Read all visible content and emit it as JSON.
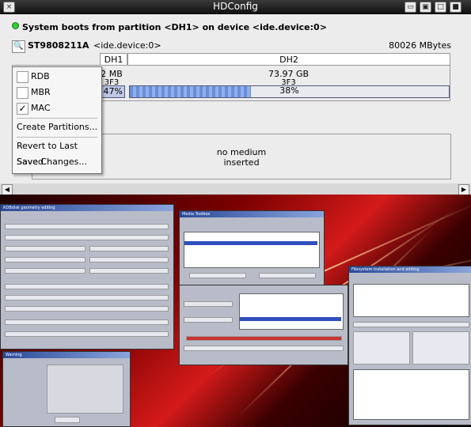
{
  "window": {
    "title": "HDConfig",
    "buttons": [
      "×",
      "□",
      "▣",
      "▢",
      "■"
    ]
  },
  "boot": {
    "text": "System boots from partition <DH1> on device <ide.device:0>"
  },
  "drive": {
    "name": "ST9808211A",
    "device": "<ide.device:0>",
    "capacity": "80026 MBytes"
  },
  "partitions": [
    {
      "name": "DH1",
      "size": "2 MB",
      "fs": "3F3",
      "usage": "47%"
    },
    {
      "name": "DH2",
      "size": "73.97 GB",
      "fs": "3F3",
      "usage": "38%"
    }
  ],
  "menu": {
    "items": [
      {
        "label": "RDB",
        "checked": false
      },
      {
        "label": "MBR",
        "checked": false
      },
      {
        "label": "MAC",
        "checked": true
      }
    ],
    "create": "Create Partitions...",
    "revert": "Revert to Last Saved",
    "save": "Save Changes..."
  },
  "media": {
    "line1": "no medium",
    "line2": "inserted"
  },
  "screenshots": {
    "left_title": "RDBdisk geometry editing",
    "middle_title": "Media Toolbox",
    "right_title": "Filesystem installation and editing",
    "dialog_title": "Warning"
  }
}
